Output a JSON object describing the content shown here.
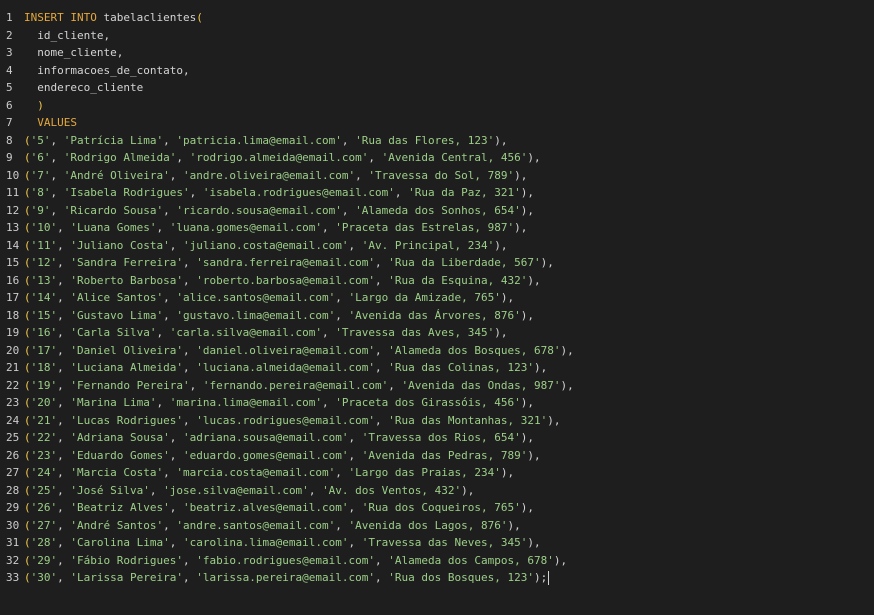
{
  "editor": {
    "line_numbers": [
      "1",
      "2",
      "3",
      "4",
      "5",
      "6",
      "7",
      "8",
      "9",
      "10",
      "11",
      "12",
      "13",
      "14",
      "15",
      "16",
      "17",
      "18",
      "19",
      "20",
      "21",
      "22",
      "23",
      "24",
      "25",
      "26",
      "27",
      "28",
      "29",
      "30",
      "31",
      "32",
      "33"
    ],
    "header": {
      "insert_kw": "INSERT INTO",
      "table": "tabelaclientes",
      "open_paren": "(",
      "columns": [
        "id_cliente,",
        "nome_cliente,",
        "informacoes_de_contato,",
        "endereco_cliente"
      ],
      "close_paren": ")",
      "values_kw": "VALUES"
    },
    "rows": [
      [
        "'5'",
        "'Patrícia Lima'",
        "'patricia.lima@email.com'",
        "'Rua das Flores, 123'"
      ],
      [
        "'6'",
        "'Rodrigo Almeida'",
        "'rodrigo.almeida@email.com'",
        "'Avenida Central, 456'"
      ],
      [
        "'7'",
        "'André Oliveira'",
        "'andre.oliveira@email.com'",
        "'Travessa do Sol, 789'"
      ],
      [
        "'8'",
        "'Isabela Rodrigues'",
        "'isabela.rodrigues@email.com'",
        "'Rua da Paz, 321'"
      ],
      [
        "'9'",
        "'Ricardo Sousa'",
        "'ricardo.sousa@email.com'",
        "'Alameda dos Sonhos, 654'"
      ],
      [
        "'10'",
        "'Luana Gomes'",
        "'luana.gomes@email.com'",
        "'Praceta das Estrelas, 987'"
      ],
      [
        "'11'",
        "'Juliano Costa'",
        "'juliano.costa@email.com'",
        "'Av. Principal, 234'"
      ],
      [
        "'12'",
        "'Sandra Ferreira'",
        "'sandra.ferreira@email.com'",
        "'Rua da Liberdade, 567'"
      ],
      [
        "'13'",
        "'Roberto Barbosa'",
        "'roberto.barbosa@email.com'",
        "'Rua da Esquina, 432'"
      ],
      [
        "'14'",
        "'Alice Santos'",
        "'alice.santos@email.com'",
        "'Largo da Amizade, 765'"
      ],
      [
        "'15'",
        "'Gustavo Lima'",
        "'gustavo.lima@email.com'",
        "'Avenida das Árvores, 876'"
      ],
      [
        "'16'",
        "'Carla Silva'",
        "'carla.silva@email.com'",
        "'Travessa das Aves, 345'"
      ],
      [
        "'17'",
        "'Daniel Oliveira'",
        "'daniel.oliveira@email.com'",
        "'Alameda dos Bosques, 678'"
      ],
      [
        "'18'",
        "'Luciana Almeida'",
        "'luciana.almeida@email.com'",
        "'Rua das Colinas, 123'"
      ],
      [
        "'19'",
        "'Fernando Pereira'",
        "'fernando.pereira@email.com'",
        "'Avenida das Ondas, 987'"
      ],
      [
        "'20'",
        "'Marina Lima'",
        "'marina.lima@email.com'",
        "'Praceta dos Girassóis, 456'"
      ],
      [
        "'21'",
        "'Lucas Rodrigues'",
        "'lucas.rodrigues@email.com'",
        "'Rua das Montanhas, 321'"
      ],
      [
        "'22'",
        "'Adriana Sousa'",
        "'adriana.sousa@email.com'",
        "'Travessa dos Rios, 654'"
      ],
      [
        "'23'",
        "'Eduardo Gomes'",
        "'eduardo.gomes@email.com'",
        "'Avenida das Pedras, 789'"
      ],
      [
        "'24'",
        "'Marcia Costa'",
        "'marcia.costa@email.com'",
        "'Largo das Praias, 234'"
      ],
      [
        "'25'",
        "'José Silva'",
        "'jose.silva@email.com'",
        "'Av. dos Ventos, 432'"
      ],
      [
        "'26'",
        "'Beatriz Alves'",
        "'beatriz.alves@email.com'",
        "'Rua dos Coqueiros, 765'"
      ],
      [
        "'27'",
        "'André Santos'",
        "'andre.santos@email.com'",
        "'Avenida dos Lagos, 876'"
      ],
      [
        "'28'",
        "'Carolina Lima'",
        "'carolina.lima@email.com'",
        "'Travessa das Neves, 345'"
      ],
      [
        "'29'",
        "'Fábio Rodrigues'",
        "'fabio.rodrigues@email.com'",
        "'Alameda dos Campos, 678'"
      ],
      [
        "'30'",
        "'Larissa Pereira'",
        "'larissa.pereira@email.com'",
        "'Rua dos Bosques, 123'"
      ]
    ],
    "row_end": "),",
    "last_row_end": ");",
    "colors": {
      "background": "#1e1e1e",
      "keyword": "#e5a83b",
      "string": "#9cce88",
      "text": "#d4d4d4"
    }
  }
}
